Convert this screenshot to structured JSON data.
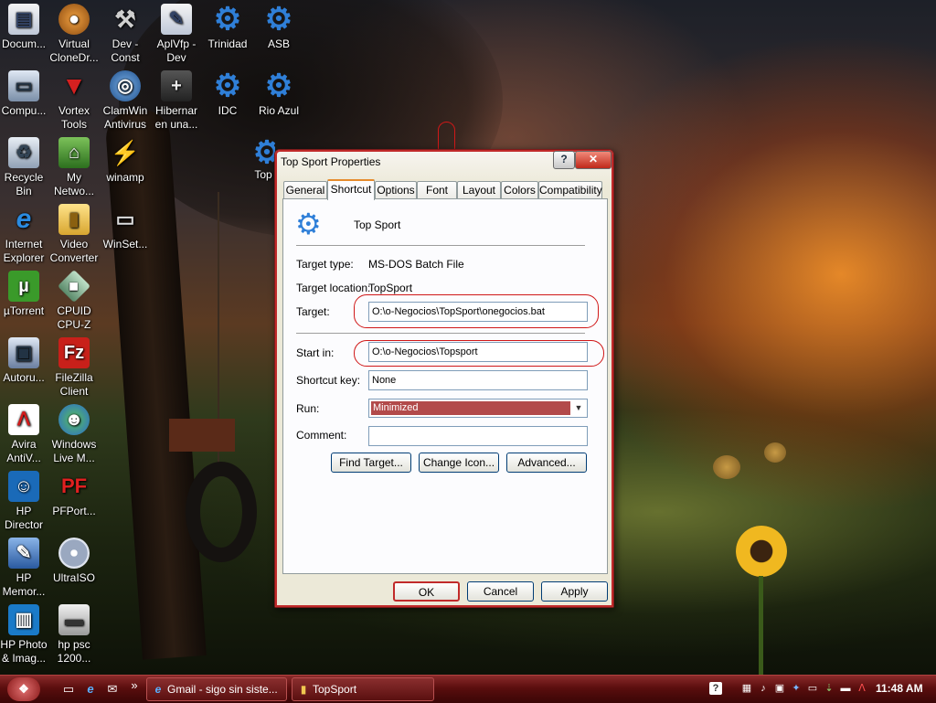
{
  "desktop_icons": [
    {
      "label": "Docum...",
      "icon": "document-icon"
    },
    {
      "label": "Virtual CloneDr...",
      "icon": "cow-icon"
    },
    {
      "label": "Dev - Const",
      "icon": "hammer-icon"
    },
    {
      "label": "AplVfp - Dev",
      "icon": "shortcut-icon"
    },
    {
      "label": "Trinidad",
      "icon": "gear-icon"
    },
    {
      "label": "ASB",
      "icon": "gear-icon"
    },
    {
      "label": "Compu...",
      "icon": "computer-icon"
    },
    {
      "label": "Vortex Tools",
      "icon": "vortex-icon"
    },
    {
      "label": "ClamWin Antivirus",
      "icon": "clamwin-icon"
    },
    {
      "label": "Hibernar en una...",
      "icon": "hibernate-icon"
    },
    {
      "label": "IDC",
      "icon": "gear-icon"
    },
    {
      "label": "Rio Azul",
      "icon": "gear-icon"
    },
    {
      "label": "Recycle Bin",
      "icon": "recycle-bin-icon"
    },
    {
      "label": "My Netwo...",
      "icon": "network-icon"
    },
    {
      "label": "winamp",
      "icon": "winamp-icon"
    },
    {
      "label": "Top",
      "icon": "gear-icon"
    },
    {
      "label": "Internet Explorer",
      "icon": "ie-icon"
    },
    {
      "label": "Video Converter",
      "icon": "folder-icon"
    },
    {
      "label": "WinSet...",
      "icon": "usb-icon"
    },
    {
      "label": "µTorrent",
      "icon": "utorrent-icon"
    },
    {
      "label": "CPUID CPU-Z",
      "icon": "cpuid-icon"
    },
    {
      "label": "Autoru...",
      "icon": "autorun-icon"
    },
    {
      "label": "FileZilla Client",
      "icon": "filezilla-icon"
    },
    {
      "label": "Avira AntiV...",
      "icon": "avira-icon"
    },
    {
      "label": "Windows Live M...",
      "icon": "messenger-icon"
    },
    {
      "label": "HP Director",
      "icon": "hp-director-icon"
    },
    {
      "label": "PFPort...",
      "icon": "pfport-icon"
    },
    {
      "label": "HP Memor...",
      "icon": "hp-memories-icon"
    },
    {
      "label": "UltraISO",
      "icon": "disc-icon"
    },
    {
      "label": "HP Photo & Imag...",
      "icon": "hp-photo-icon"
    },
    {
      "label": "hp psc 1200...",
      "icon": "printer-icon"
    }
  ],
  "dialog": {
    "title": "Top Sport Properties",
    "help_label": "?",
    "close_label": "✕",
    "tabs": [
      "General",
      "Shortcut",
      "Options",
      "Font",
      "Layout",
      "Colors",
      "Compatibility"
    ],
    "active_tab": "Shortcut",
    "shortcut_name": "Top Sport",
    "target_type_label": "Target type:",
    "target_type_value": "MS-DOS Batch File",
    "target_location_label": "Target location:",
    "target_location_value": "TopSport",
    "target_label": "Target:",
    "target_value": "O:\\o-Negocios\\TopSport\\onegocios.bat",
    "start_in_label": "Start in:",
    "start_in_value": "O:\\o-Negocios\\Topsport",
    "shortcut_key_label": "Shortcut key:",
    "shortcut_key_value": "None",
    "run_label": "Run:",
    "run_value": "Minimized",
    "comment_label": "Comment:",
    "comment_value": "",
    "find_target_label": "Find Target...",
    "change_icon_label": "Change Icon...",
    "advanced_label": "Advanced...",
    "ok_label": "OK",
    "cancel_label": "Cancel",
    "apply_label": "Apply"
  },
  "taskbar": {
    "tasks": [
      {
        "label": "Gmail - sigo sin siste...",
        "icon": "ie-icon"
      },
      {
        "label": "TopSport",
        "icon": "folder-icon"
      }
    ],
    "overflow_label": "»",
    "clock": "11:48 AM"
  },
  "colors": {
    "accent": "#c12a2a",
    "annotation_ring": "#d01818",
    "taskbar": "#5a0e0e"
  }
}
